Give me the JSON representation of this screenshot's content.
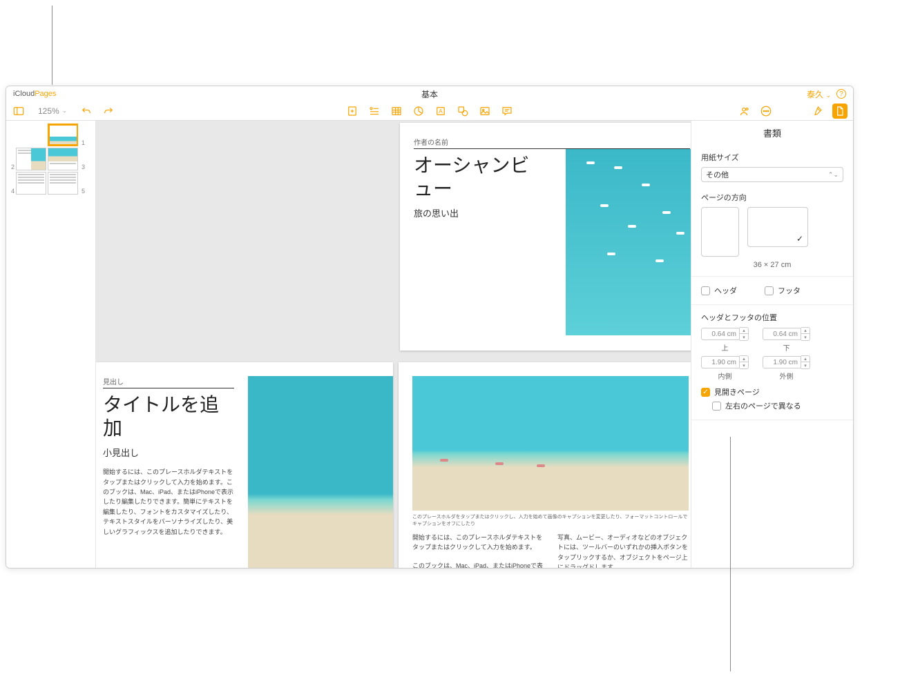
{
  "titlebar": {
    "brand_icloud": "iCloud",
    "brand_pages": "Pages",
    "doc_title": "基本",
    "user_name": "泰久"
  },
  "toolbar": {
    "zoom": "125%"
  },
  "thumbnails": {
    "p1": "1",
    "p2": "2",
    "p3": "3",
    "p4": "4",
    "p5": "5"
  },
  "page1": {
    "author_label": "作者の名前",
    "title": "オーシャンビュー",
    "subtitle": "旅の思い出"
  },
  "page2": {
    "heading_label": "見出し",
    "title": "タイトルを追加",
    "subtitle": "小見出し",
    "body": "開始するには、このプレースホルダテキストをタップまたはクリックして入力を始めます。このブックは、Mac、iPad、またはiPhoneで表示したり編集したりできます。簡単にテキストを編集したり、フォントをカスタマイズしたり、テキストスタイルをパーソナライズしたり、美しいグラフィックスを追加したりできます。"
  },
  "page3": {
    "caption": "このプレースホルダをタップまたはクリックし、入力を始めて画像のキャプションを変更したり、フォーマットコントロールでキャプションをオフにしたり",
    "col1a": "開始するには、このプレースホルダテキストをタップまたはクリックして入力を始めます。",
    "col1b": "このブックは、Mac、iPad、またはiPhoneで表示したり編集",
    "col2": "写真、ムービー、オーディオなどのオブジェクトには、ツールバーのいずれかの挿入ボタンをタップリックするか、オブジェクトをページ上にドラッグドします。"
  },
  "inspector": {
    "title": "書類",
    "paper_size_label": "用紙サイズ",
    "paper_size_value": "その他",
    "orientation_label": "ページの方向",
    "dimensions": "36 × 27 cm",
    "header_label": "ヘッダ",
    "footer_label": "フッタ",
    "hf_position_label": "ヘッダとフッタの位置",
    "margin_top_value": "0.64 cm",
    "margin_top_label": "上",
    "margin_bottom_value": "0.64 cm",
    "margin_bottom_label": "下",
    "margin_inner_value": "1.90 cm",
    "margin_inner_label": "内側",
    "margin_outer_value": "1.90 cm",
    "margin_outer_label": "外側",
    "facing_pages": "見開きページ",
    "different_lr": "左右のページで異なる"
  }
}
